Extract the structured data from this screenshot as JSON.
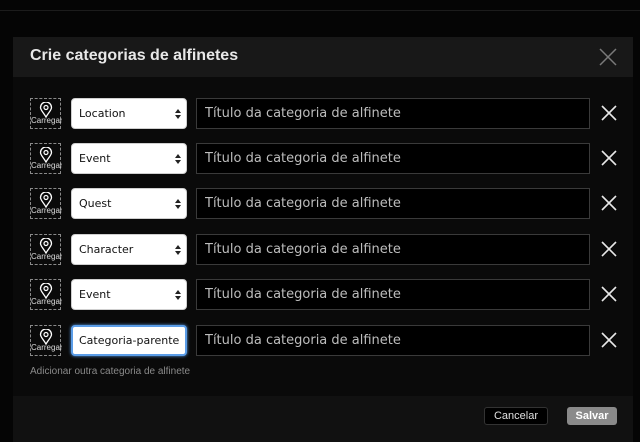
{
  "modal": {
    "title": "Crie categorias de alfinetes"
  },
  "rows": [
    {
      "upload_label": "Carregar",
      "category": "Location",
      "title_placeholder": "Título da categoria de alfinete"
    },
    {
      "upload_label": "Carregar",
      "category": "Event",
      "title_placeholder": "Título da categoria de alfinete"
    },
    {
      "upload_label": "Carregar",
      "category": "Quest",
      "title_placeholder": "Título da categoria de alfinete"
    },
    {
      "upload_label": "Carregar",
      "category": "Character",
      "title_placeholder": "Título da categoria de alfinete"
    },
    {
      "upload_label": "Carregar",
      "category": "Event",
      "title_placeholder": "Título da categoria de alfinete"
    },
    {
      "upload_label": "Carregar",
      "category": "Categoria-parente",
      "title_placeholder": "Título da categoria de alfinete"
    }
  ],
  "add_link": "Adicionar outra categoria de alfinete",
  "footer": {
    "cancel_label": "Cancelar",
    "save_label": "Salvar"
  },
  "icons": {
    "close": "close-icon",
    "remove": "remove-row-icon",
    "upload": "map-pin-icon",
    "select_arrows": "select-arrows-icon"
  },
  "colors": {
    "focus": "#5b9de8",
    "save_button": "#8a8a8a"
  }
}
